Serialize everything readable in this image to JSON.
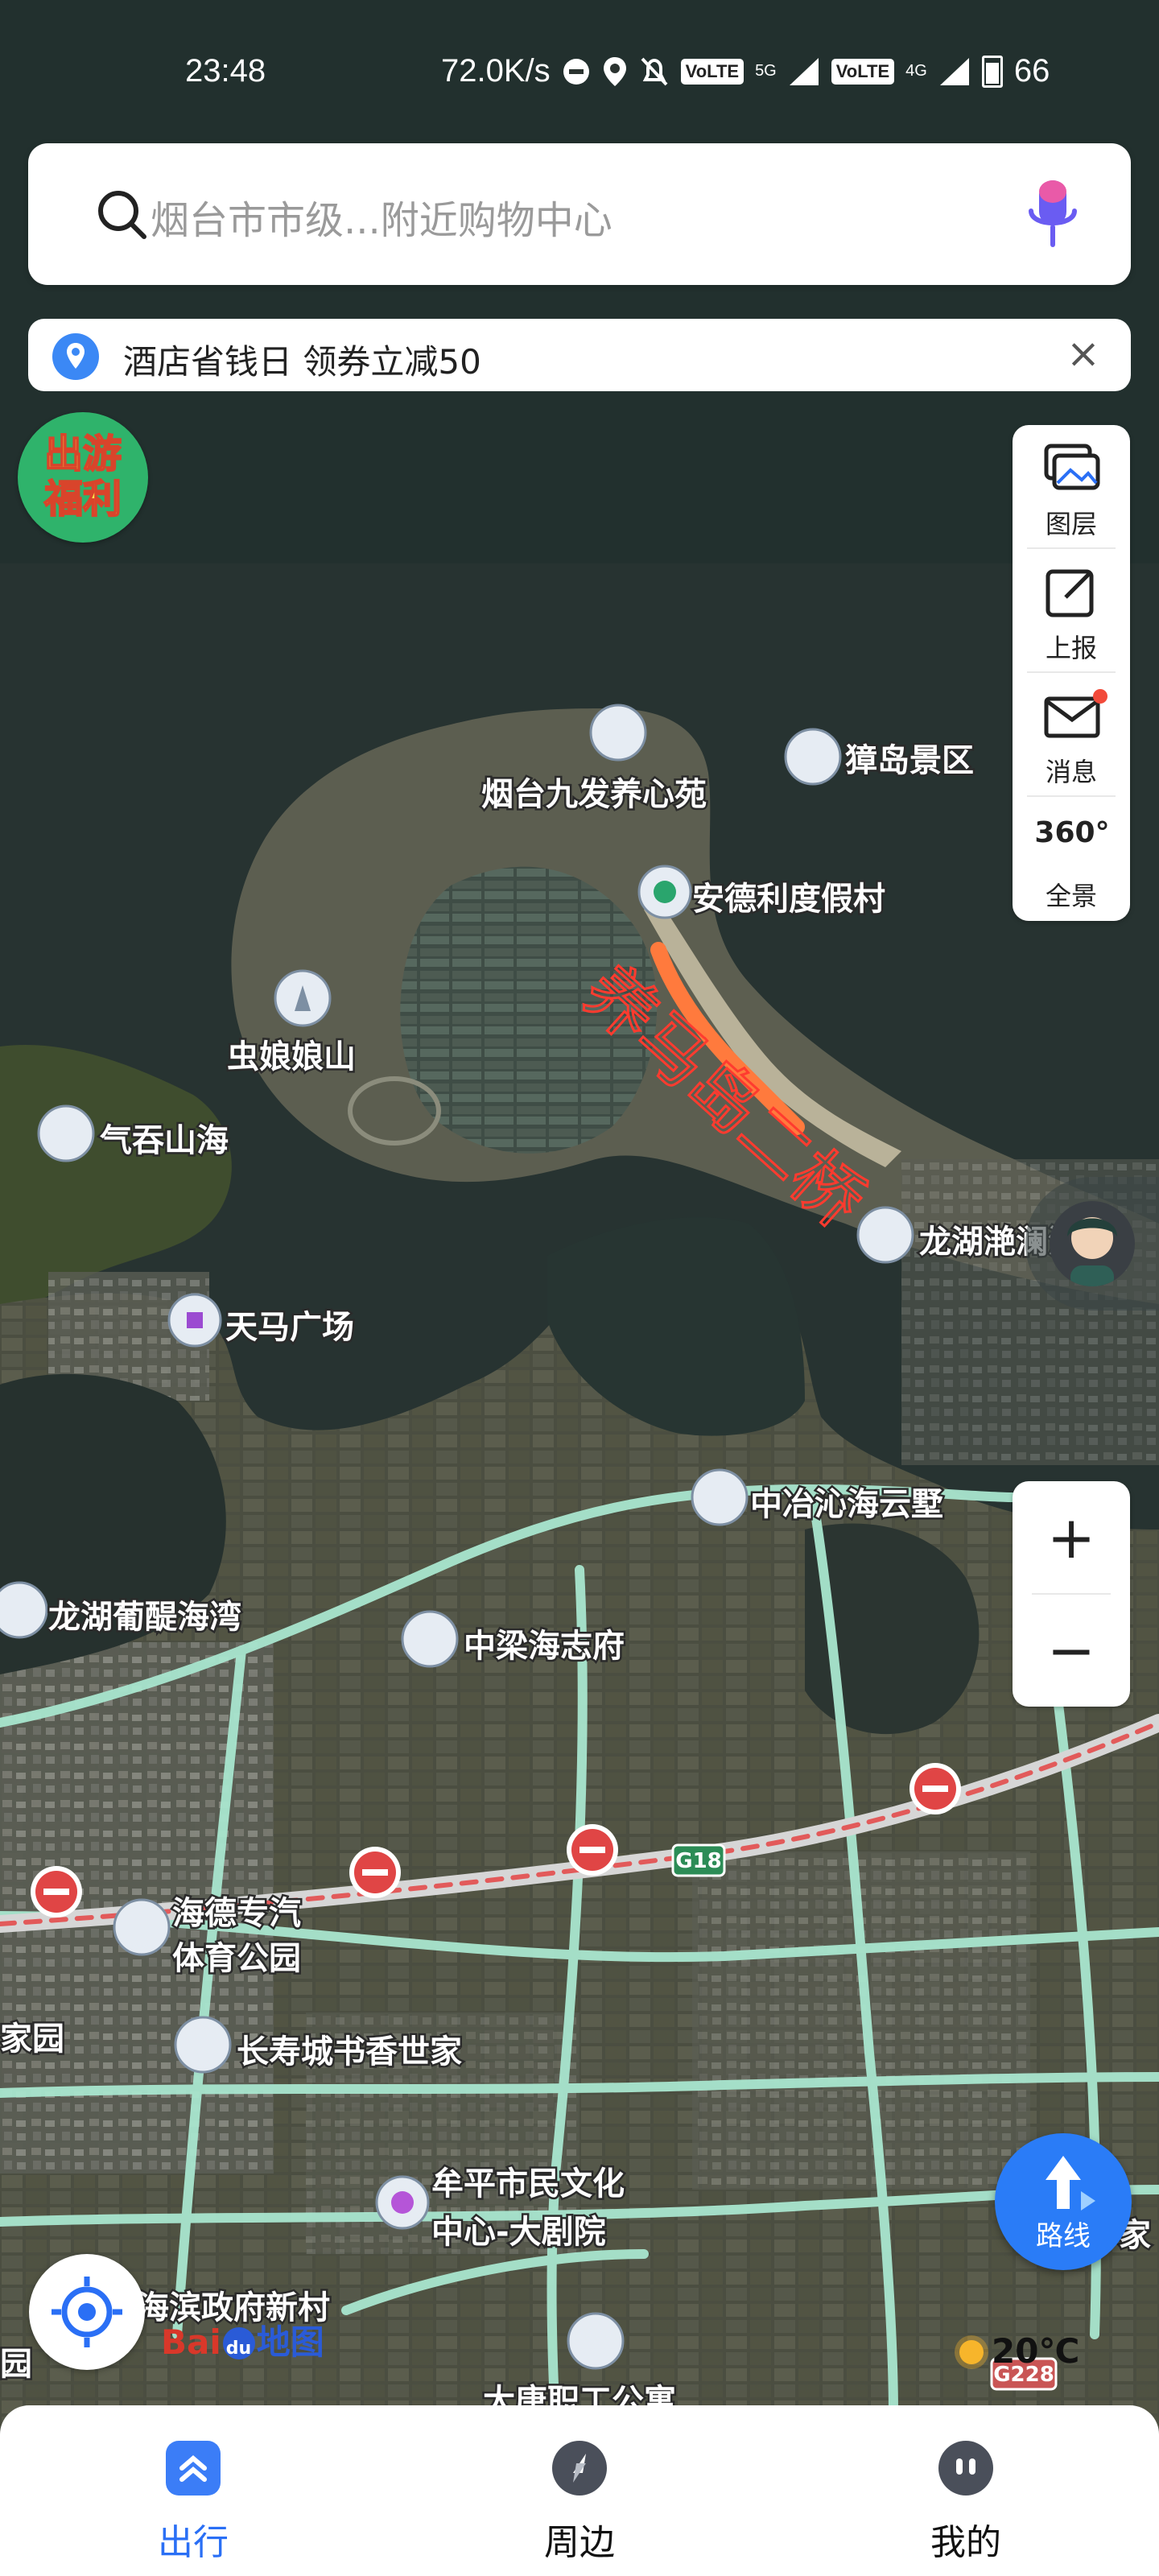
{
  "status_bar": {
    "time": "23:48",
    "speed": "72.0K/s",
    "sim1": "VoLTE",
    "sim1_net": "5G",
    "sim2": "VoLTE",
    "sim2_net": "4G",
    "battery": "66",
    "icons": [
      "minus-circle-icon",
      "location-icon",
      "bell-off-icon",
      "signal-icon",
      "battery-icon"
    ]
  },
  "search": {
    "placeholder": "烟台市市级...附近购物中心",
    "icon": "search-icon",
    "voice_icon": "microphone-icon"
  },
  "promo": {
    "text": "酒店省钱日 领券立减50",
    "icon": "location-pin-icon",
    "close_icon": "close-icon"
  },
  "travel_badge": {
    "line1": "出游",
    "line2": "福利"
  },
  "tools": [
    {
      "label": "图层",
      "icon": "layers-icon"
    },
    {
      "label": "上报",
      "icon": "report-edit-icon"
    },
    {
      "label": "消息",
      "icon": "mail-icon",
      "has_dot": true
    },
    {
      "label": "全景",
      "icon": "panorama-360-icon",
      "icon_text": "360°"
    }
  ],
  "zoom": {
    "in": "+",
    "out": "−"
  },
  "route": {
    "label": "路线",
    "icon": "route-arrow-icon"
  },
  "locate": {
    "icon": "locate-crosshair-icon"
  },
  "logo": {
    "part1": "Bai",
    "part2": "du",
    "part3": "地图"
  },
  "weather": {
    "temp": "20℃",
    "icon": "sun-icon"
  },
  "map": {
    "annotation": "养马岛二桥",
    "route_badges": [
      "G18",
      "G228"
    ],
    "pois": [
      {
        "name": "烟台九发养心苑",
        "type": "building"
      },
      {
        "name": "獐岛景区",
        "type": "building"
      },
      {
        "name": "安德利度假村",
        "type": "resort"
      },
      {
        "name": "虫娘娘山",
        "type": "mountain"
      },
      {
        "name": "气吞山海",
        "type": "building"
      },
      {
        "name": "龙湖滟澜海岸",
        "type": "building"
      },
      {
        "name": "天马广场",
        "type": "shopping"
      },
      {
        "name": "中冶沁海云墅",
        "type": "building"
      },
      {
        "name": "龙湖葡醍海湾",
        "type": "building"
      },
      {
        "name": "中梁海志府",
        "type": "building"
      },
      {
        "name": "海德专汽",
        "type": "building"
      },
      {
        "name": "体育公园",
        "type": "label"
      },
      {
        "name": "家园",
        "type": "label"
      },
      {
        "name": "长寿城书香世家",
        "type": "building"
      },
      {
        "name": "牟平市民文化",
        "type": "culture"
      },
      {
        "name": "中心-大剧院",
        "type": "label"
      },
      {
        "name": "海滨政府新村",
        "type": "label"
      },
      {
        "name": "园",
        "type": "label"
      },
      {
        "name": "家",
        "type": "label"
      },
      {
        "name": "大唐职工公寓",
        "type": "building"
      }
    ]
  },
  "bottom_nav": [
    {
      "label": "出行",
      "icon": "travel-chevrons-icon",
      "active": true
    },
    {
      "label": "周边",
      "icon": "compass-icon",
      "active": false
    },
    {
      "label": "我的",
      "icon": "profile-face-icon",
      "active": false
    }
  ],
  "colors": {
    "accent": "#2a6ff5",
    "road": "#a9e6cf",
    "annotation": "#ff3b2f",
    "highlight": "#ff7a3d"
  }
}
